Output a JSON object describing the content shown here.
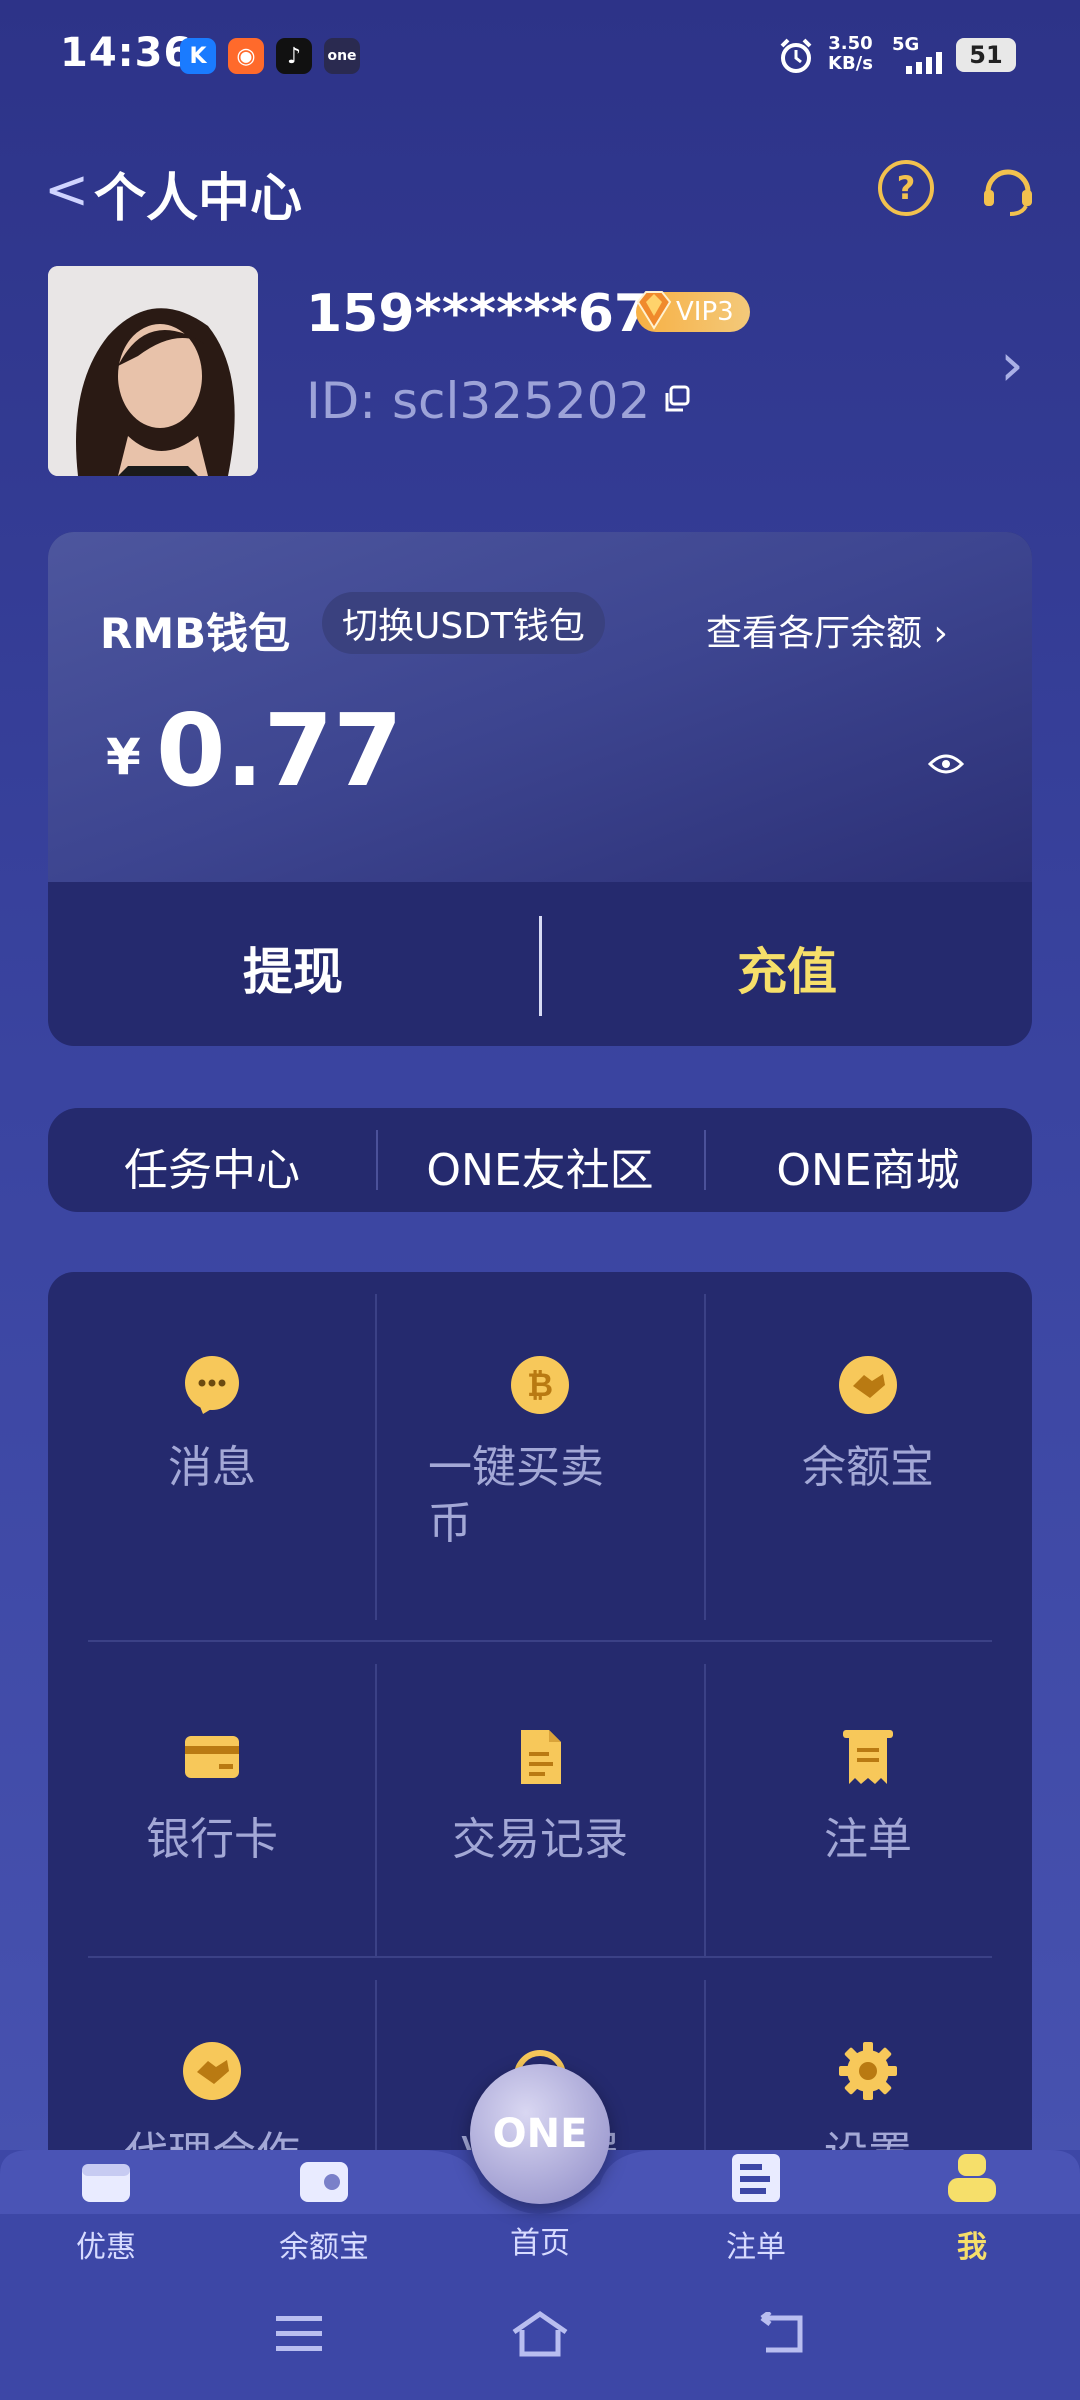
{
  "status_bar": {
    "time": "14:36",
    "net_speed": "3.50",
    "net_unit": "KB/s",
    "network": "5G",
    "battery": "51"
  },
  "header": {
    "title": "个人中心"
  },
  "profile": {
    "phone": "159******67",
    "vip": "VIP3",
    "user_id": "ID: scl325202"
  },
  "wallet": {
    "title": "RMB钱包",
    "switch_label": "切换USDT钱包",
    "view_all": "查看各厅余额",
    "currency": "¥",
    "balance": "0.77",
    "withdraw": "提现",
    "deposit": "充值",
    "deposit_color": "#f6df6a"
  },
  "quick_links": [
    "任务中心",
    "ONE友社区",
    "ONE商城"
  ],
  "grid": [
    {
      "label": "消息",
      "icon": "message-icon"
    },
    {
      "label": "一键买卖币",
      "icon": "bitcoin-icon"
    },
    {
      "label": "余额宝",
      "icon": "handshake-icon"
    },
    {
      "label": "银行卡",
      "icon": "bank-card-icon"
    },
    {
      "label": "交易记录",
      "icon": "document-icon"
    },
    {
      "label": "注单",
      "icon": "receipt-icon"
    },
    {
      "label": "代理合作",
      "icon": "handshake-icon"
    },
    {
      "label": "VIP客服",
      "icon": "headset-icon"
    },
    {
      "label": "设置",
      "icon": "gear-icon"
    }
  ],
  "bottom_nav": {
    "tabs": [
      {
        "label": "优惠",
        "icon": "gift-icon"
      },
      {
        "label": "余额宝",
        "icon": "wallet-icon"
      },
      {
        "label": "首页",
        "icon": "home-logo-icon"
      },
      {
        "label": "注单",
        "icon": "list-icon"
      },
      {
        "label": "我",
        "icon": "profile-icon"
      }
    ],
    "center_logo": "ONE",
    "active_color": "#f6df6a"
  },
  "colors": {
    "accent": "#f2c14e",
    "card": "#252a6e"
  }
}
